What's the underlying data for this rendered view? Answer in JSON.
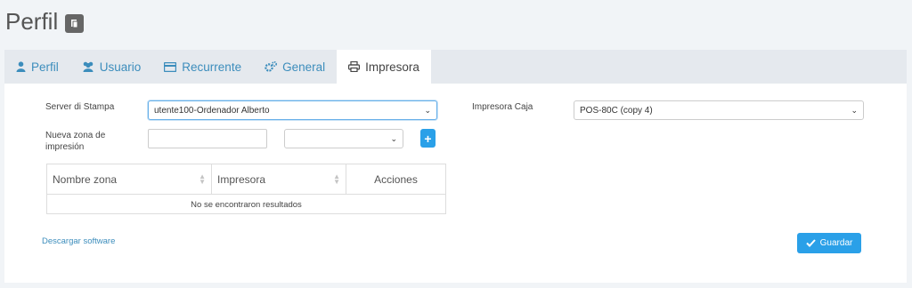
{
  "page": {
    "title": "Perfil"
  },
  "tabs": [
    {
      "label": "Perfil",
      "icon": "user-icon"
    },
    {
      "label": "Usuario",
      "icon": "users-icon"
    },
    {
      "label": "Recurrente",
      "icon": "credit-card-icon"
    },
    {
      "label": "General",
      "icon": "gears-icon"
    },
    {
      "label": "Impresora",
      "icon": "printer-icon",
      "active": true
    }
  ],
  "form": {
    "server_label": "Server di Stampa",
    "server_value": "utente100-Ordenador Alberto",
    "zona_label_1": "Nueva zona de",
    "zona_label_2": "impresión",
    "zona_input_value": "",
    "zona_select_value": "",
    "caja_label": "Impresora Caja",
    "caja_value": "POS-80C (copy 4)"
  },
  "table": {
    "headers": [
      "Nombre zona",
      "Impresora",
      "Acciones"
    ],
    "empty_text": "No se encontraron resultados"
  },
  "links": {
    "download": "Descargar software"
  },
  "buttons": {
    "save": "Guardar",
    "add": "+"
  },
  "colors": {
    "accent": "#2aa0e8",
    "link": "#3c8dbc"
  }
}
